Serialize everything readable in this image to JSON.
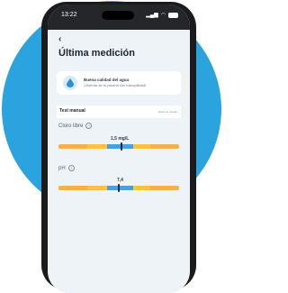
{
  "statusbar": {
    "time": "13:22",
    "battery": "▮"
  },
  "header": {
    "back_icon": "‹",
    "title": "Última medición"
  },
  "quality_card": {
    "title": "Buena calidad del agua",
    "subtitle": "¡Disfruta de tu piscina con tranquilidad!"
  },
  "section": {
    "title": "Test manual",
    "link": "Hace un minuto"
  },
  "parameters": [
    {
      "label": "Cloro libre",
      "value": "1,5 mg/L",
      "level": 0.52
    },
    {
      "label": "pH",
      "value": "7,4",
      "level": 0.5
    }
  ],
  "colors": {
    "background_circle": "#2aa3de",
    "scale_low": "#f4b04a",
    "scale_mid": "#ffc13f",
    "scale_ok": "#4a9fe0"
  }
}
